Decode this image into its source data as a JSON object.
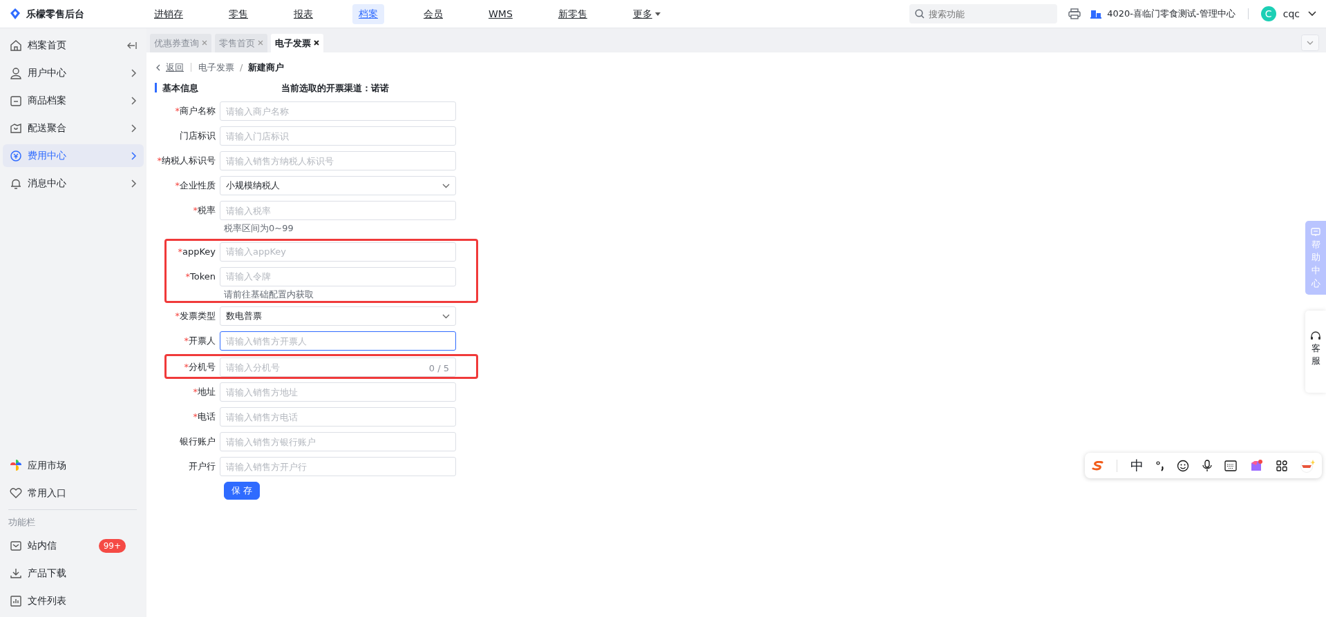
{
  "app": {
    "name": "乐檬零售后台"
  },
  "top_nav": [
    {
      "label": "进销存",
      "selected": false
    },
    {
      "label": "零售",
      "selected": false
    },
    {
      "label": "报表",
      "selected": false
    },
    {
      "label": "档案",
      "selected": true
    },
    {
      "label": "会员",
      "selected": false
    },
    {
      "label": "WMS",
      "selected": false
    },
    {
      "label": "新零售",
      "selected": false
    }
  ],
  "more_menu": {
    "label": "更多"
  },
  "search": {
    "placeholder": "搜索功能"
  },
  "store": "4020-喜临门零食测试-管理中心",
  "user": {
    "avatar": "C",
    "name": "cqc"
  },
  "sidebar": {
    "items": [
      {
        "label": "档案首页",
        "kind": "home",
        "selected": false
      },
      {
        "label": "用户中心",
        "kind": "group",
        "selected": false
      },
      {
        "label": "商品档案",
        "kind": "group",
        "selected": false
      },
      {
        "label": "配送聚合",
        "kind": "group",
        "selected": false
      },
      {
        "label": "费用中心",
        "kind": "group",
        "selected": true
      },
      {
        "label": "消息中心",
        "kind": "group",
        "selected": false
      }
    ],
    "bottom_items": [
      {
        "label": "应用市场"
      },
      {
        "label": "常用入口"
      }
    ],
    "section_title": "功能栏",
    "tools": [
      {
        "label": "站内信",
        "badge": "99+"
      },
      {
        "label": "产品下载"
      },
      {
        "label": "文件列表"
      }
    ]
  },
  "tabs": [
    {
      "label": "优惠券查询",
      "selected": false
    },
    {
      "label": "零售首页",
      "selected": false
    },
    {
      "label": "电子发票",
      "selected": true
    }
  ],
  "breadcrumb": {
    "back": "返回",
    "separator": "/",
    "items": [
      "电子发票",
      "新建商户"
    ]
  },
  "section": {
    "title": "基本信息",
    "channel_note": "当前选取的开票渠道：诺诺"
  },
  "form_groups": [
    {
      "highlighted": false,
      "fields": [
        {
          "label": "商户名称",
          "required": true,
          "kind": "input",
          "placeholder": "请输入商户名称",
          "focused": false
        },
        {
          "label": "门店标识",
          "required": false,
          "kind": "input",
          "placeholder": "请输入门店标识",
          "focused": false
        },
        {
          "label": "纳税人标识号",
          "required": true,
          "kind": "input",
          "placeholder": "请输入销售方纳税人标识号",
          "focused": false
        },
        {
          "label": "企业性质",
          "required": true,
          "kind": "select",
          "value": "小规模纳税人",
          "focused": false
        },
        {
          "label": "税率",
          "required": true,
          "kind": "input",
          "placeholder": "请输入税率",
          "hint": "税率区间为0~99",
          "focused": false
        }
      ]
    },
    {
      "highlighted": true,
      "fields": [
        {
          "label": "appKey",
          "required": true,
          "kind": "input",
          "placeholder": "请输入appKey",
          "focused": false
        },
        {
          "label": "Token",
          "required": true,
          "kind": "input",
          "placeholder": "请输入令牌",
          "hint": "请前往基础配置内获取",
          "focused": false
        }
      ]
    },
    {
      "highlighted": false,
      "fields": [
        {
          "label": "发票类型",
          "required": true,
          "kind": "select",
          "value": "数电普票",
          "focused": false
        },
        {
          "label": "开票人",
          "required": true,
          "kind": "input",
          "placeholder": "请输入销售方开票人",
          "focused": true
        }
      ]
    },
    {
      "highlighted": true,
      "fields": [
        {
          "label": "分机号",
          "required": true,
          "kind": "input",
          "placeholder": "请输入分机号",
          "counter": "0 / 5",
          "focused": false
        }
      ]
    },
    {
      "highlighted": false,
      "fields": [
        {
          "label": "地址",
          "required": true,
          "kind": "input",
          "placeholder": "请输入销售方地址",
          "focused": false
        },
        {
          "label": "电话",
          "required": true,
          "kind": "input",
          "placeholder": "请输入销售方电话",
          "focused": false
        },
        {
          "label": "银行账户",
          "required": false,
          "kind": "input",
          "placeholder": "请输入销售方银行账户",
          "focused": false
        },
        {
          "label": "开户行",
          "required": false,
          "kind": "input",
          "placeholder": "请输入销售方开户行",
          "focused": false
        }
      ]
    }
  ],
  "required_marker": "*",
  "save_button": "保 存",
  "help_panel": {
    "label": "帮助中心"
  },
  "service": {
    "label": "客服"
  },
  "ime": {
    "mode": "中"
  }
}
